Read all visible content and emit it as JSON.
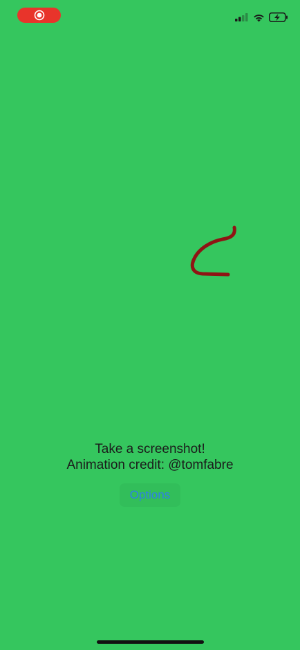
{
  "status_bar": {
    "recording_icon": "screen-record-icon",
    "signal_icon": "cellular-signal-icon",
    "wifi_icon": "wifi-icon",
    "battery_icon": "battery-charging-icon"
  },
  "main": {
    "animation_icon": "red-stroke-drawing",
    "caption_line1": "Take a screenshot!",
    "caption_line2": "Animation credit: @tomfabre",
    "options_label": "Options"
  },
  "colors": {
    "background": "#35c65e",
    "recording_pill": "#e8342b",
    "stroke": "#8f1414",
    "button_text": "#2f7fe6"
  }
}
